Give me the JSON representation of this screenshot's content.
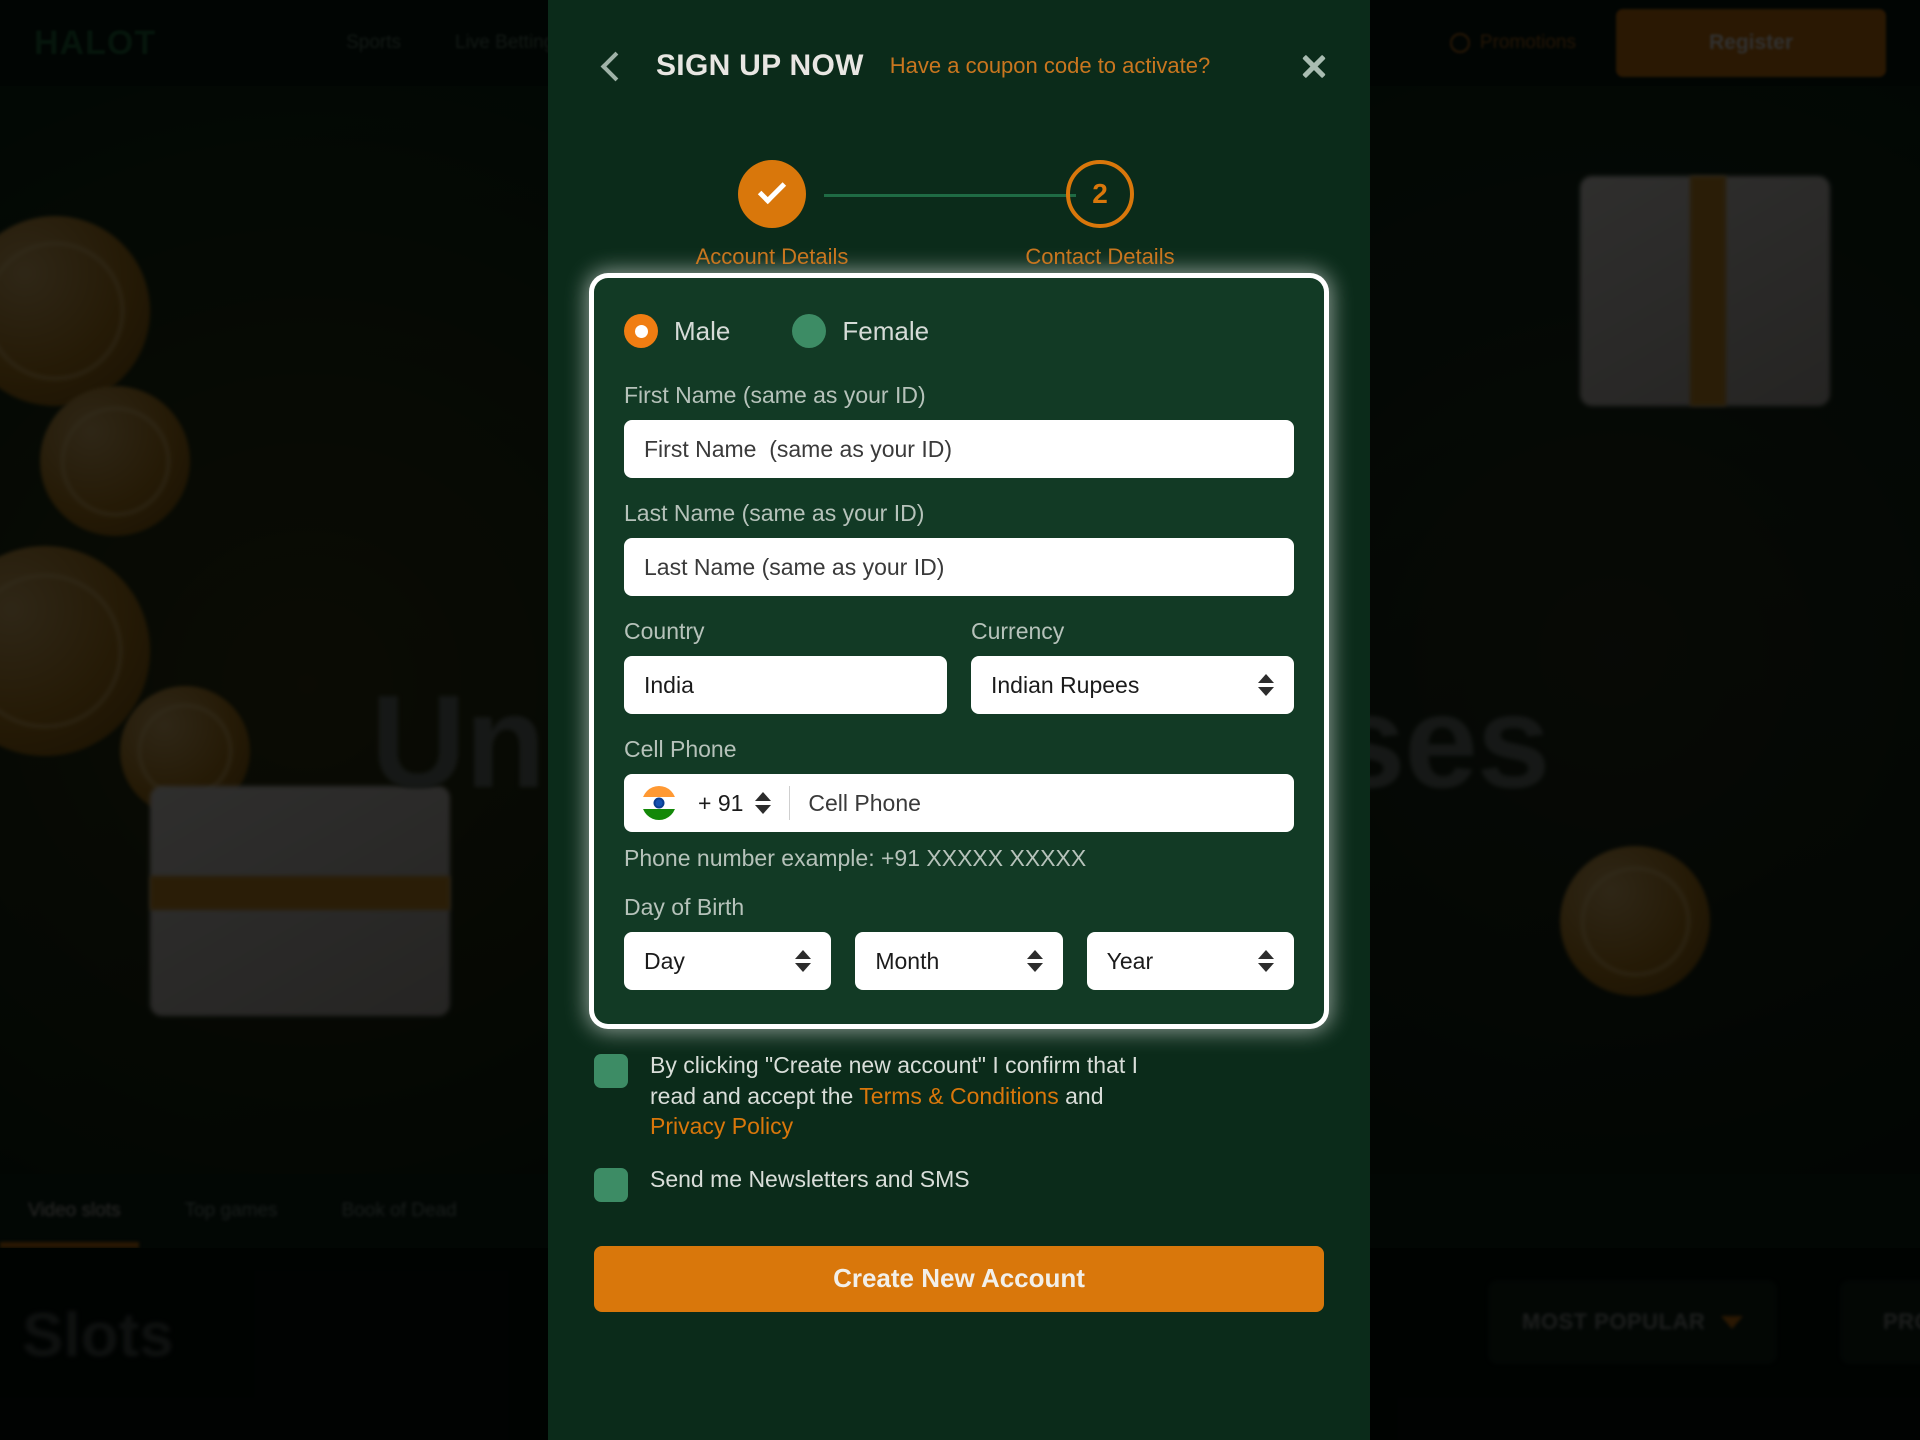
{
  "background": {
    "logo": "HALOT",
    "nav": [
      "Sports",
      "Live Betting"
    ],
    "promotions_label": "Promotions",
    "register_label": "Register",
    "hero_heading": "Unlimited Bonuses",
    "game_tabs": [
      "Video slots",
      "Top games",
      "Book of Dead"
    ],
    "active_game_tab": "Video slots",
    "section_title": "Slots",
    "filter_chips": [
      "MOST POPULAR",
      "PROVIDERS"
    ]
  },
  "modal": {
    "back_icon": "chevron-left-icon",
    "title": "SIGN UP NOW",
    "coupon_link": "Have a coupon code to activate?",
    "close_icon": "close-icon",
    "stepper": {
      "steps": [
        {
          "number": "1",
          "label": "Account Details",
          "state": "completed",
          "glyph": "check"
        },
        {
          "number": "2",
          "label": "Contact Details",
          "state": "active",
          "glyph": "2"
        }
      ]
    },
    "form": {
      "gender": {
        "selected": "Male",
        "options": [
          {
            "label": "Male",
            "selected": true
          },
          {
            "label": "Female",
            "selected": false
          }
        ]
      },
      "first_name": {
        "label": "First Name (same as your ID)",
        "placeholder": "First Name  (same as your ID)",
        "value": ""
      },
      "last_name": {
        "label": "Last Name (same as your ID)",
        "placeholder": "Last Name (same as your ID)",
        "value": ""
      },
      "country": {
        "label": "Country",
        "value": "India"
      },
      "currency": {
        "label": "Currency",
        "value": "Indian Rupees"
      },
      "cell_phone": {
        "label": "Cell Phone",
        "flag": "india-flag-icon",
        "dial_code": "+ 91",
        "placeholder": "Cell Phone",
        "value": "",
        "hint": "Phone number example: +91 XXXXX XXXXX"
      },
      "day_of_birth": {
        "label": "Day of Birth",
        "day": "Day",
        "month": "Month",
        "year": "Year"
      }
    },
    "consents": [
      {
        "checked": false,
        "text_before": "By clicking \"Create new account\" I confirm that I read and accept the ",
        "link1": "Terms & Conditions",
        "text_middle": " and ",
        "link2": "Privacy Policy",
        "text_after": ""
      },
      {
        "checked": false,
        "text_before": "Send me Newsletters and SMS",
        "link1": "",
        "text_middle": "",
        "link2": "",
        "text_after": ""
      }
    ],
    "submit_label": "Create New Account"
  },
  "colors": {
    "accent_orange": "#d9770b",
    "panel_green": "#123a25",
    "modal_green": "#0b2b1a",
    "radio_unselected": "#3d8c65",
    "link_orange": "#c9761f"
  }
}
